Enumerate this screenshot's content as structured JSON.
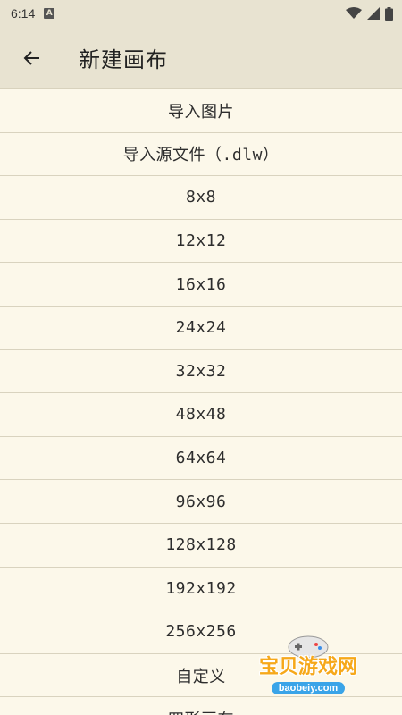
{
  "status_bar": {
    "time": "6:14",
    "notification_badge": "A"
  },
  "app_bar": {
    "title": "新建画布"
  },
  "items": [
    {
      "label": "导入图片"
    },
    {
      "label": "导入源文件（.dlw）"
    },
    {
      "label": "8x8"
    },
    {
      "label": "12x12"
    },
    {
      "label": "16x16"
    },
    {
      "label": "24x24"
    },
    {
      "label": "32x32"
    },
    {
      "label": "48x48"
    },
    {
      "label": "64x64"
    },
    {
      "label": "96x96"
    },
    {
      "label": "128x128"
    },
    {
      "label": "192x192"
    },
    {
      "label": "256x256"
    },
    {
      "label": "自定义"
    },
    {
      "label": "四形画布"
    }
  ],
  "watermark": {
    "text": "宝贝游戏网",
    "url": "baobeiy.com"
  },
  "colors": {
    "background": "#fcf8ea",
    "app_bar": "#e8e3d1",
    "divider": "#d9d3bf",
    "watermark": "#f6a81a"
  }
}
